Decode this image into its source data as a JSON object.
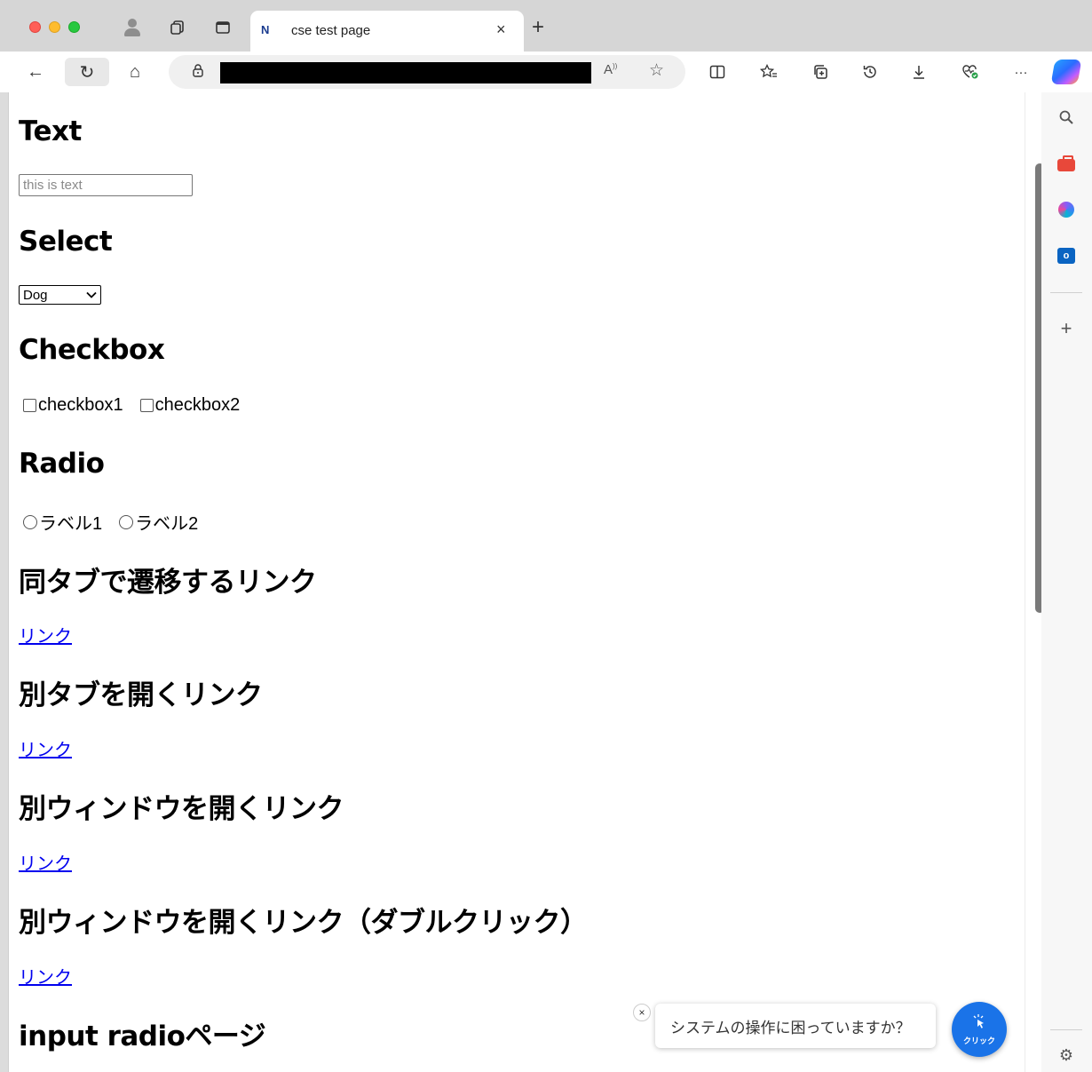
{
  "browser": {
    "tab": {
      "favicon": "N",
      "title": "cse test page",
      "close": "×"
    },
    "new_tab": "+",
    "icons": {
      "back": "←",
      "refresh": "↻",
      "home": "⌂",
      "lock": "🔒",
      "read_aloud": "A",
      "favorite": "☆",
      "split": "◫",
      "favorites": "☆",
      "collections": "⧉",
      "history": "⟲",
      "downloads": "⤓",
      "health": "♡",
      "more": "···"
    }
  },
  "page": {
    "sections": {
      "text": {
        "heading": "Text",
        "placeholder": "this is text"
      },
      "select": {
        "heading": "Select",
        "value": "Dog"
      },
      "checkbox": {
        "heading": "Checkbox",
        "options": [
          "checkbox1",
          "checkbox2"
        ]
      },
      "radio": {
        "heading": "Radio",
        "options": [
          "ラベル1",
          "ラベル2"
        ]
      },
      "same_tab": {
        "heading": "同タブで遷移するリンク",
        "link": "リンク"
      },
      "new_tab": {
        "heading": "別タブを開くリンク",
        "link": "リンク"
      },
      "new_window": {
        "heading": "別ウィンドウを開くリンク",
        "link": "リンク"
      },
      "new_window_dbl": {
        "heading": "別ウィンドウを開くリンク（ダブルクリック）",
        "link": "リンク"
      },
      "input_radio": {
        "heading": "input radioページ"
      }
    }
  },
  "help_widget": {
    "message": "システムの操作に困っていますか？",
    "button_label": "クリック",
    "close": "×"
  },
  "sidebar": {
    "icons": [
      "search-icon",
      "tools-icon",
      "m365-icon",
      "outlook-icon",
      "add-icon",
      "settings-icon"
    ],
    "add": "+",
    "settings": "⚙"
  },
  "colors": {
    "link": "#0000ee",
    "help_button": "#1a73e8",
    "traffic_red": "#ff5f57",
    "traffic_yellow": "#febc2e",
    "traffic_green": "#28c840"
  }
}
